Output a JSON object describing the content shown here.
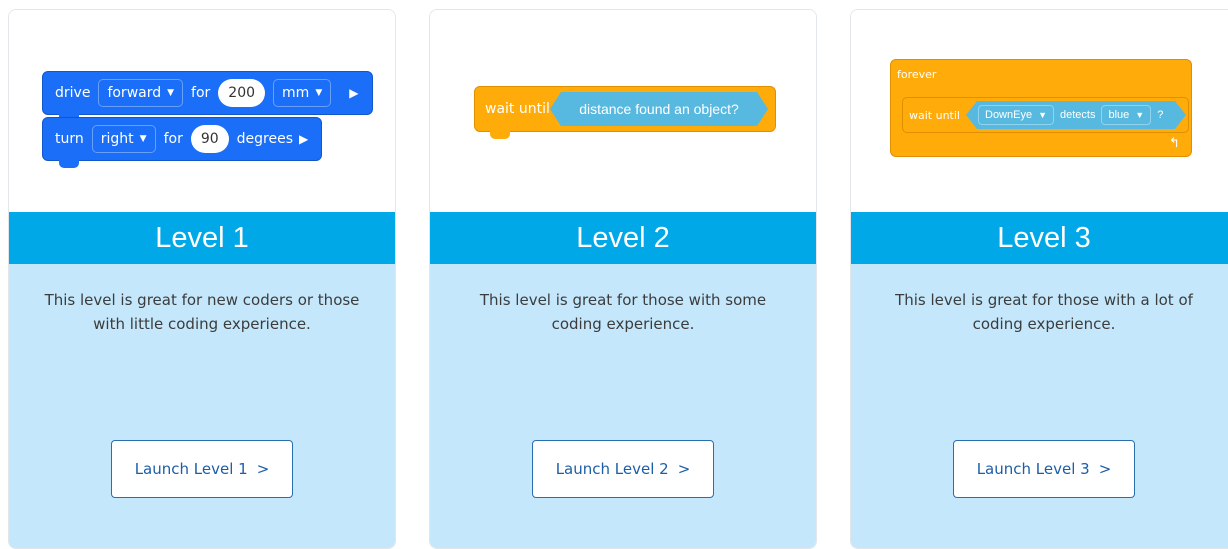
{
  "cards": [
    {
      "title": "Level 1",
      "description": "This level is great for new coders or those with little coding experience.",
      "button_label": "Launch Level 1",
      "button_chevron": ">",
      "blocks": {
        "row1": {
          "word1": "drive",
          "dropdown1": "forward",
          "word2": "for",
          "value": "200",
          "dropdown2": "mm"
        },
        "row2": {
          "word1": "turn",
          "dropdown1": "right",
          "word2": "for",
          "value": "90",
          "word3": "degrees"
        }
      }
    },
    {
      "title": "Level 2",
      "description": "This level is great for those with some coding experience.",
      "button_label": "Launch Level 2",
      "button_chevron": ">",
      "blocks": {
        "word": "wait until",
        "condition": "distance found an object?"
      }
    },
    {
      "title": "Level 3",
      "description": "This level is great for those with a lot of coding experience.",
      "button_label": "Launch Level 3",
      "button_chevron": ">",
      "blocks": {
        "loop": "forever",
        "word": "wait until",
        "sensor": "DownEye",
        "verb": "detects",
        "color": "blue",
        "q": "?"
      }
    }
  ],
  "colors": {
    "band": "#00a8e8",
    "body": "#c4e7fb",
    "blue_block": "#1a6ef7",
    "orange_block": "#ffab0a",
    "sensor_block": "#58b9e0"
  }
}
